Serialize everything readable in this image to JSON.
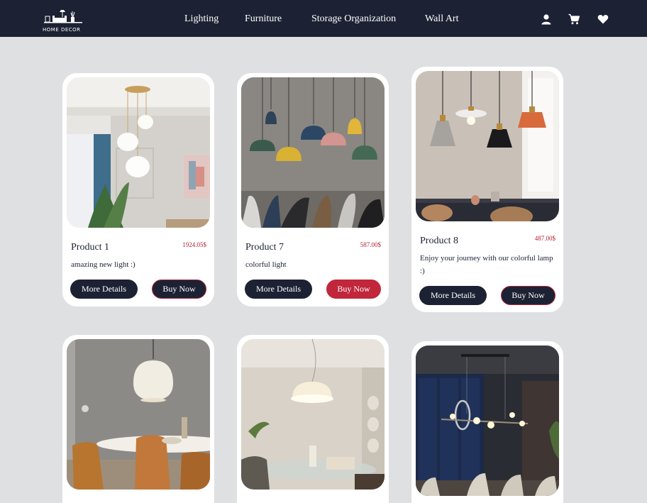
{
  "brand": {
    "logo_text": "HOME DECOR"
  },
  "nav": {
    "links": [
      "Lighting",
      "Furniture",
      "Storage Organization",
      "Wall Art"
    ],
    "icons": [
      "user-icon",
      "cart-icon",
      "heart-icon"
    ]
  },
  "colors": {
    "navbar": "#1c2233",
    "page_bg": "#dfe0e2",
    "price": "#b02235",
    "buy_now_active": "#c1263a"
  },
  "products": [
    {
      "name": "Product 1",
      "price": "1924.05$",
      "description": "amazing new light :)",
      "details_label": "More Details",
      "buy_label": "Buy Now"
    },
    {
      "name": "Product 7",
      "price": "587.00$",
      "description": "colorful light",
      "details_label": "More Details",
      "buy_label": "Buy Now"
    },
    {
      "name": "Product 8",
      "price": "487.00$",
      "description": "Enjoy your journey with our colorful lamp :)",
      "details_label": "More Details",
      "buy_label": "Buy Now"
    }
  ]
}
